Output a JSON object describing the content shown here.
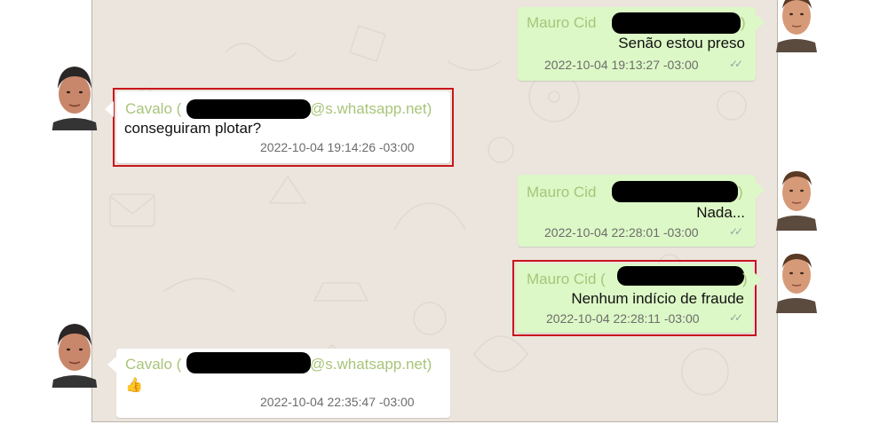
{
  "messages": [
    {
      "direction": "outgoing",
      "sender": "Mauro Cid",
      "sender_suffix": ")",
      "text": "Senão estou preso",
      "timestamp": "2022-10-04 19:13:27 -03:00",
      "highlighted": false
    },
    {
      "direction": "incoming",
      "sender": "Cavalo (",
      "sender_suffix": "@s.whatsapp.net)",
      "text": "conseguiram plotar?",
      "timestamp": "2022-10-04 19:14:26 -03:00",
      "highlighted": true
    },
    {
      "direction": "outgoing",
      "sender": "Mauro Cid",
      "sender_suffix": ")",
      "text": "Nada...",
      "timestamp": "2022-10-04 22:28:01 -03:00",
      "highlighted": false
    },
    {
      "direction": "outgoing",
      "sender": "Mauro Cid (",
      "sender_suffix": ")",
      "text": "Nenhum indício de fraude",
      "timestamp": "2022-10-04 22:28:11 -03:00",
      "highlighted": true
    },
    {
      "direction": "incoming",
      "sender": "Cavalo (",
      "sender_suffix": "@s.whatsapp.net)",
      "text": "👍",
      "timestamp": "2022-10-04 22:35:47 -03:00",
      "highlighted": false
    }
  ],
  "read_ticks": "✓✓",
  "colors": {
    "chat_background": "#ece5dd",
    "outgoing_bubble": "#dcf8c6",
    "incoming_bubble": "#ffffff",
    "sender_name": "#a9c47a",
    "highlight_border": "#c8161d",
    "redaction": "#000000"
  }
}
